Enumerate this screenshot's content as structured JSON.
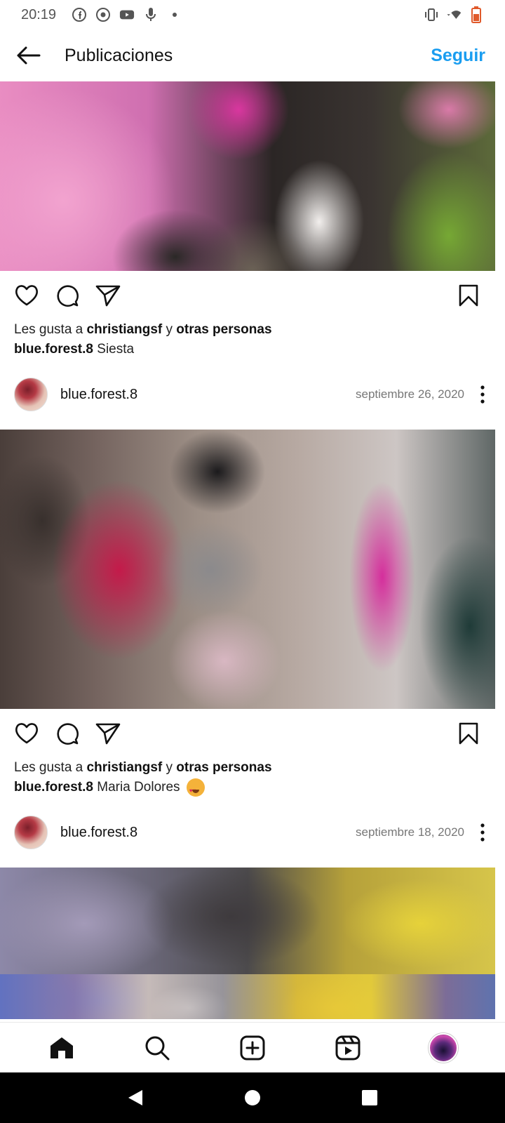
{
  "status_bar": {
    "time": "20:19",
    "left_icons": [
      "facebook-icon",
      "chrome-icon",
      "youtube-icon",
      "mic-icon",
      "dot-icon"
    ],
    "right_icons": [
      "vibrate-icon",
      "wifi-icon",
      "battery-icon"
    ]
  },
  "header": {
    "title": "Publicaciones",
    "follow_label": "Seguir",
    "accent_color": "#1a9df0"
  },
  "posts": [
    {
      "likes_prefix": "Les gusta a",
      "likes_user": "christiangsf",
      "likes_joiner": "y",
      "likes_others": "otras personas",
      "caption_user": "blue.forest.8",
      "caption_text": "Siesta"
    },
    {
      "username": "blue.forest.8",
      "date": "septiembre 26, 2020",
      "likes_prefix": "Les gusta a",
      "likes_user": "christiangsf",
      "likes_joiner": "y",
      "likes_others": "otras personas",
      "caption_user": "blue.forest.8",
      "caption_text": "Maria Dolores",
      "caption_emoji": "heart-eyes-cat-emoji"
    },
    {
      "username": "blue.forest.8",
      "date": "septiembre 18, 2020"
    }
  ],
  "bottom_nav": {
    "items": [
      "home-icon",
      "search-icon",
      "create-icon",
      "reels-icon",
      "profile-avatar"
    ]
  },
  "system_nav": {
    "items": [
      "back-triangle-icon",
      "home-circle-icon",
      "recents-square-icon"
    ]
  }
}
